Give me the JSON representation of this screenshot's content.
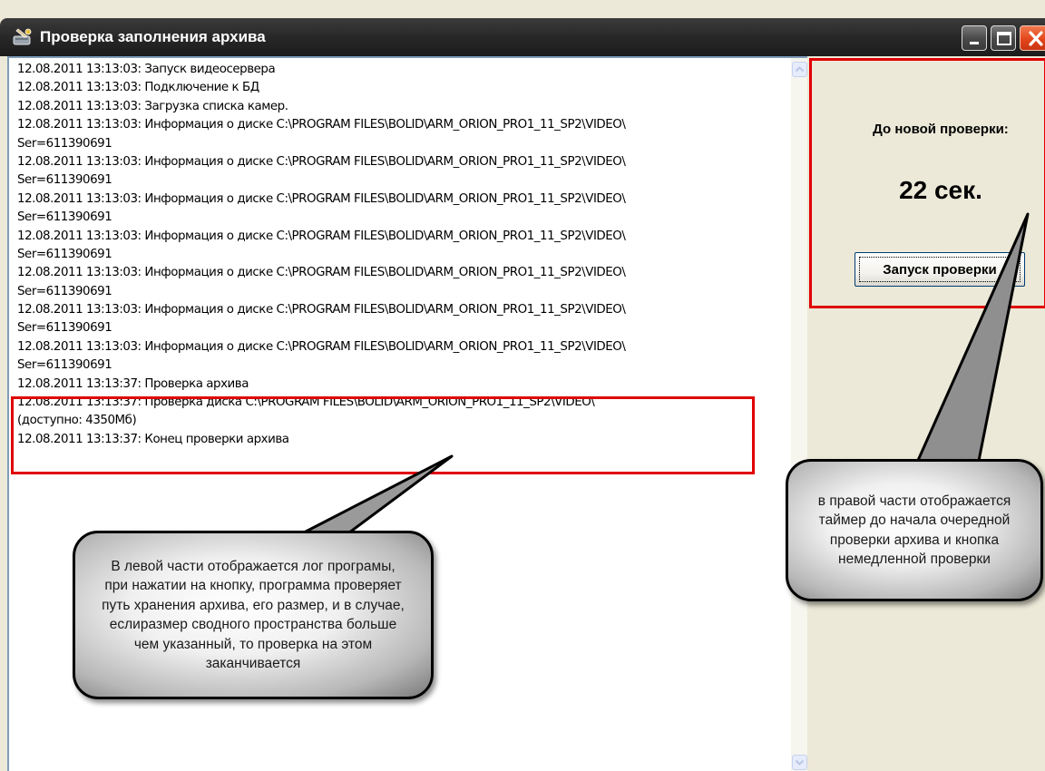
{
  "window": {
    "title": "Проверка заполнения архива"
  },
  "log": {
    "lines": [
      "12.08.2011 13:13:03: Запуск видеосервера",
      "12.08.2011 13:13:03: Подключение к БД",
      "12.08.2011 13:13:03: Загрузка списка камер.",
      "12.08.2011 13:13:03: Информация о диске C:\\PROGRAM FILES\\BOLID\\ARM_ORION_PRO1_11_SP2\\VIDEO\\",
      "Ser=611390691",
      "12.08.2011 13:13:03: Информация о диске C:\\PROGRAM FILES\\BOLID\\ARM_ORION_PRO1_11_SP2\\VIDEO\\",
      "Ser=611390691",
      "12.08.2011 13:13:03: Информация о диске C:\\PROGRAM FILES\\BOLID\\ARM_ORION_PRO1_11_SP2\\VIDEO\\",
      "Ser=611390691",
      "12.08.2011 13:13:03: Информация о диске C:\\PROGRAM FILES\\BOLID\\ARM_ORION_PRO1_11_SP2\\VIDEO\\",
      "Ser=611390691",
      "12.08.2011 13:13:03: Информация о диске C:\\PROGRAM FILES\\BOLID\\ARM_ORION_PRO1_11_SP2\\VIDEO\\",
      "Ser=611390691",
      "12.08.2011 13:13:03: Информация о диске C:\\PROGRAM FILES\\BOLID\\ARM_ORION_PRO1_11_SP2\\VIDEO\\",
      "Ser=611390691",
      "12.08.2011 13:13:03: Информация о диске C:\\PROGRAM FILES\\BOLID\\ARM_ORION_PRO1_11_SP2\\VIDEO\\",
      "Ser=611390691",
      "12.08.2011 13:13:37: Проверка архива",
      "12.08.2011 13:13:37: Проверка диска C:\\PROGRAM FILES\\BOLID\\ARM_ORION_PRO1_11_SP2\\VIDEO\\",
      "(доступно: 4350Мб)",
      "12.08.2011 13:13:37: Конец проверки архива"
    ]
  },
  "panel": {
    "next_check_label": "До новой проверки:",
    "timer": "22 сек.",
    "run_button": "Запуск проверки"
  },
  "callouts": {
    "left_text": "В левой части отображается лог програмы, при нажатии на кнопку, программа проверяет путь хранения архива, его размер, и в случае, еслиразмер сводного пространства больше чем указанный, то проверка на этом заканчивается",
    "right_text": "в правой части отображается таймер до начала очередной проверки архива и кнопка немедленной проверки"
  },
  "icons": {
    "app": "archive-check-icon",
    "minimize": "minimize-icon",
    "maximize": "maximize-icon",
    "close": "close-icon",
    "scroll_up": "chevron-up-icon",
    "scroll_down": "chevron-down-icon"
  },
  "colors": {
    "highlight": "#e00000",
    "titlebar": "#2b2b2b",
    "close_button": "#e4461c",
    "panel_bg": "#ece9d8"
  }
}
